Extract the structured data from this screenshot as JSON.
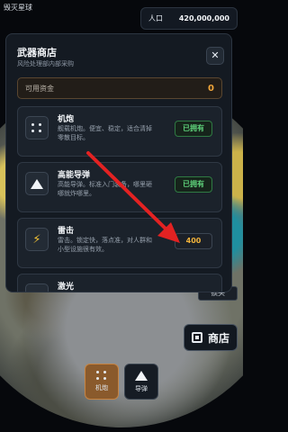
{
  "background": {
    "top_left_title": "毁灭星球",
    "population_label": "人口",
    "population_value": "420,000,000",
    "lock_label": "锁头",
    "shop_button": "商店",
    "weapon_bar": [
      {
        "label": "机炮",
        "icon": "dots-grid-icon",
        "active": true
      },
      {
        "label": "导弹",
        "icon": "triangle-icon",
        "active": false
      }
    ]
  },
  "modal": {
    "title": "武器商店",
    "subtitle": "风险处理部内部采购",
    "close_icon": "close-icon",
    "funds_label": "可用资金",
    "funds_value": "0",
    "items": [
      {
        "name": "机炮",
        "desc": "舰载机炮。便宜、稳定，适合清掉零散目标。",
        "status": "已拥有",
        "icon": "dots-grid-icon"
      },
      {
        "name": "高能导弹",
        "desc": "高能导弹。标准入门装备，哪里砸哪就炸哪里。",
        "status": "已拥有",
        "icon": "triangle-icon"
      },
      {
        "name": "雷击",
        "desc": "雷击。锁定快，落点准，对人群和小型设施很有效。",
        "price": "400",
        "icon": "lightning-icon"
      },
      {
        "name": "激光"
      }
    ]
  },
  "colors": {
    "accent_orange": "#f2b33b",
    "owned_green": "#5ed17a",
    "annotation_red": "#e32222"
  }
}
